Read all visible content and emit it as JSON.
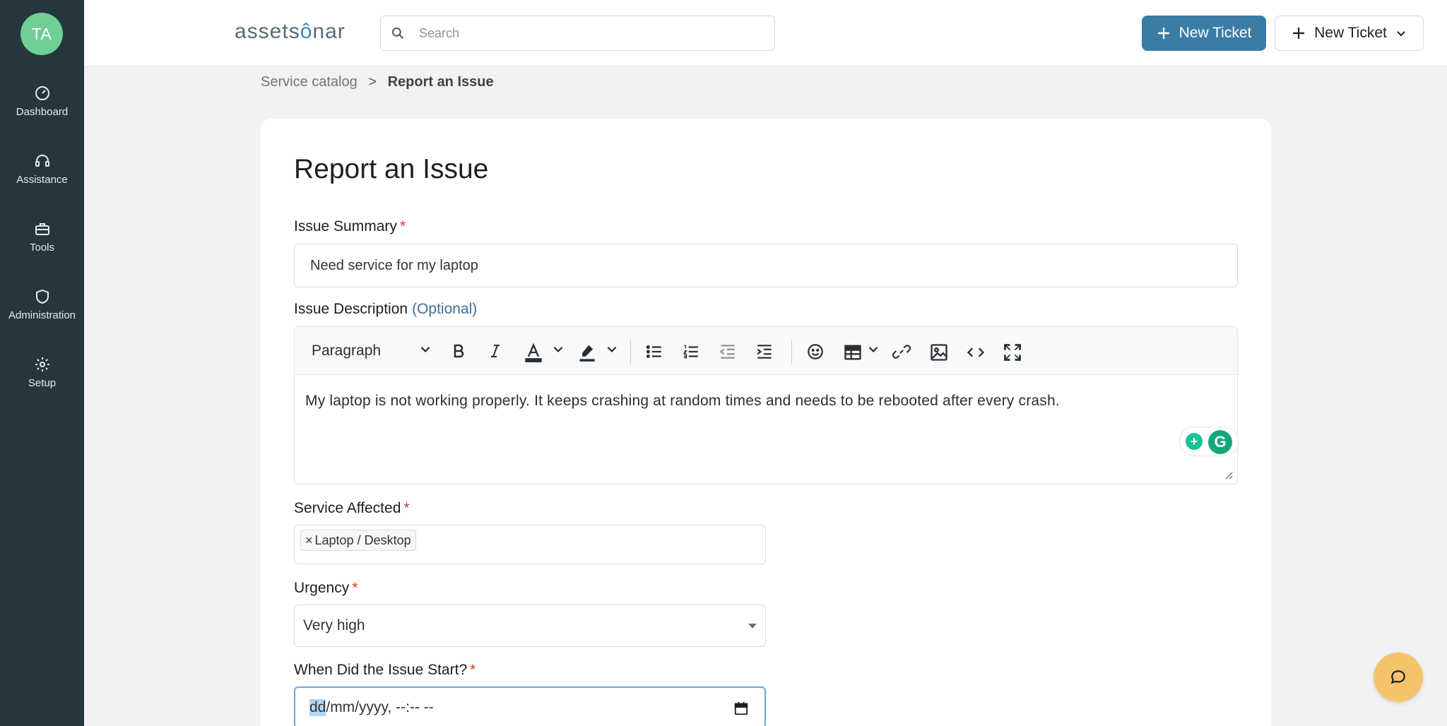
{
  "sidebar": {
    "avatar_initials": "TA",
    "items": [
      {
        "label": "Dashboard",
        "icon": "dashboard-icon"
      },
      {
        "label": "Assistance",
        "icon": "headset-icon"
      },
      {
        "label": "Tools",
        "icon": "toolbox-icon"
      },
      {
        "label": "Administration",
        "icon": "shield-icon"
      },
      {
        "label": "Setup",
        "icon": "gear-icon"
      }
    ]
  },
  "header": {
    "logo_text_a": "assets",
    "logo_text_b": "nar",
    "search_placeholder": "Search",
    "new_ticket_primary": "New Ticket",
    "new_ticket_secondary": "New Ticket"
  },
  "breadcrumb": {
    "parent": "Service catalog",
    "separator": ">",
    "current": "Report an Issue"
  },
  "form": {
    "title": "Report an Issue",
    "summary": {
      "label": "Issue Summary",
      "required": "*",
      "value": "Need service for my laptop"
    },
    "description": {
      "label": "Issue Description",
      "optional": "(Optional)",
      "block_format": "Paragraph",
      "text": "My laptop is not working properly. It keeps crashing at random times and needs to be rebooted after every crash."
    },
    "service": {
      "label": "Service Affected",
      "required": "*",
      "tag_remove": "×",
      "tag": "Laptop / Desktop"
    },
    "urgency": {
      "label": "Urgency",
      "required": "*",
      "value": "Very high"
    },
    "start": {
      "label": "When Did the Issue Start?",
      "required": "*",
      "value_highlight": "dd",
      "value_rest": "/mm/yyyy, --:-- --"
    }
  },
  "colors": {
    "sidebar_bg": "#26363f",
    "avatar_bg": "#6fcf97",
    "primary_button": "#3b7ca6",
    "required_star": "#d9342b",
    "chat_button": "#f5c46a"
  }
}
